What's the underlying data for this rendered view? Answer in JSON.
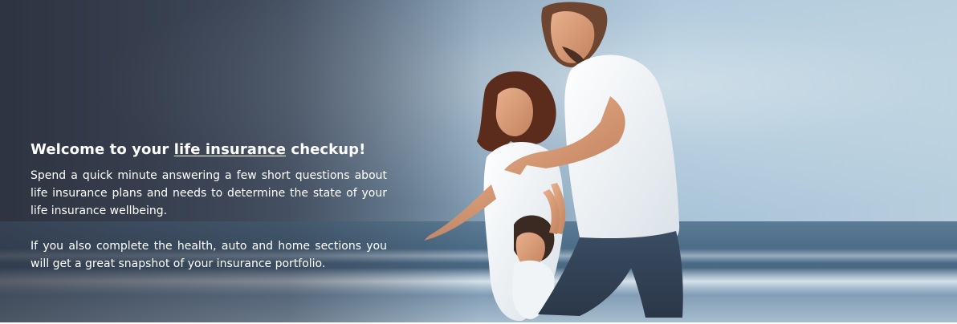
{
  "hero": {
    "headline": {
      "prefix": "Welcome to your",
      "link_text": "life insurance",
      "suffix": "checkup!"
    },
    "paragraphs": [
      "Spend a quick minute answering a few short questions about life insurance plans and needs to determine the state of your life insurance wellbeing.",
      "If you also complete the health, auto and home sections you will get a great snapshot of your insurance portfolio."
    ],
    "image": {
      "subject": "family walking on a beach"
    }
  }
}
